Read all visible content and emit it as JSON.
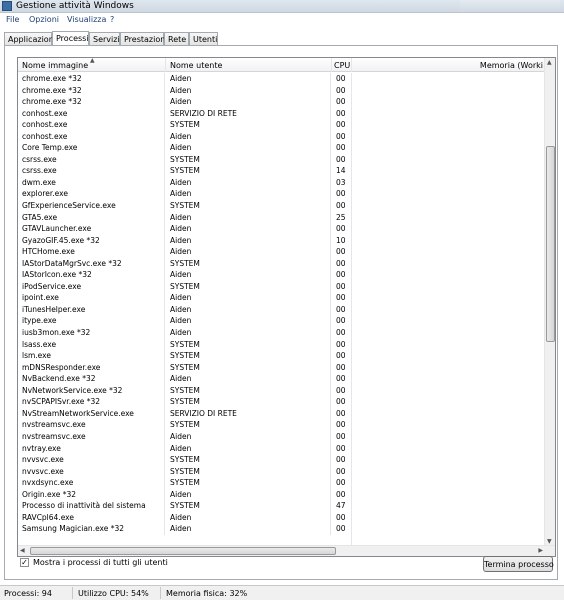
{
  "window": {
    "title": "Gestione attività Windows"
  },
  "menu": [
    "File",
    "Opzioni",
    "Visualizza",
    "?"
  ],
  "tabs": [
    "Applicazioni",
    "Processi",
    "Servizi",
    "Prestazioni",
    "Rete",
    "Utenti"
  ],
  "active_tab": "Processi",
  "columns": {
    "name": "Nome immagine",
    "user": "Nome utente",
    "cpu": "CPU",
    "memory": "Memoria (Worki"
  },
  "processes": [
    [
      "chrome.exe *32",
      "Aiden",
      "00"
    ],
    [
      "chrome.exe *32",
      "Aiden",
      "00"
    ],
    [
      "chrome.exe *32",
      "Aiden",
      "00"
    ],
    [
      "conhost.exe",
      "SERVIZIO DI RETE",
      "00"
    ],
    [
      "conhost.exe",
      "SYSTEM",
      "00"
    ],
    [
      "conhost.exe",
      "Aiden",
      "00"
    ],
    [
      "Core Temp.exe",
      "Aiden",
      "00"
    ],
    [
      "csrss.exe",
      "SYSTEM",
      "00"
    ],
    [
      "csrss.exe",
      "SYSTEM",
      "14"
    ],
    [
      "dwm.exe",
      "Aiden",
      "03"
    ],
    [
      "explorer.exe",
      "Aiden",
      "00"
    ],
    [
      "GfExperienceService.exe",
      "SYSTEM",
      "00"
    ],
    [
      "GTA5.exe",
      "Aiden",
      "25"
    ],
    [
      "GTAVLauncher.exe",
      "Aiden",
      "00"
    ],
    [
      "GyazoGIF.45.exe *32",
      "Aiden",
      "10"
    ],
    [
      "HTCHome.exe",
      "Aiden",
      "00"
    ],
    [
      "IAStorDataMgrSvc.exe *32",
      "SYSTEM",
      "00"
    ],
    [
      "IAStorIcon.exe *32",
      "Aiden",
      "00"
    ],
    [
      "iPodService.exe",
      "SYSTEM",
      "00"
    ],
    [
      "ipoint.exe",
      "Aiden",
      "00"
    ],
    [
      "iTunesHelper.exe",
      "Aiden",
      "00"
    ],
    [
      "itype.exe",
      "Aiden",
      "00"
    ],
    [
      "iusb3mon.exe *32",
      "Aiden",
      "00"
    ],
    [
      "lsass.exe",
      "SYSTEM",
      "00"
    ],
    [
      "lsm.exe",
      "SYSTEM",
      "00"
    ],
    [
      "mDNSResponder.exe",
      "SYSTEM",
      "00"
    ],
    [
      "NvBackend.exe *32",
      "Aiden",
      "00"
    ],
    [
      "NvNetworkService.exe *32",
      "SYSTEM",
      "00"
    ],
    [
      "nvSCPAPISvr.exe *32",
      "SYSTEM",
      "00"
    ],
    [
      "NvStreamNetworkService.exe",
      "SERVIZIO DI RETE",
      "00"
    ],
    [
      "nvstreamsvc.exe",
      "SYSTEM",
      "00"
    ],
    [
      "nvstreamsvc.exe",
      "Aiden",
      "00"
    ],
    [
      "nvtray.exe",
      "Aiden",
      "00"
    ],
    [
      "nvvsvc.exe",
      "SYSTEM",
      "00"
    ],
    [
      "nvvsvc.exe",
      "SYSTEM",
      "00"
    ],
    [
      "nvxdsync.exe",
      "SYSTEM",
      "00"
    ],
    [
      "Origin.exe *32",
      "Aiden",
      "00"
    ],
    [
      "Processo di inattività del sistema",
      "SYSTEM",
      "47"
    ],
    [
      "RAVCpl64.exe",
      "Aiden",
      "00"
    ],
    [
      "Samsung Magician.exe *32",
      "Aiden",
      "00"
    ]
  ],
  "show_all_users": {
    "label": "Mostra i processi di tutti gli utenti",
    "checked": true
  },
  "end_process_button": "Termina processo",
  "status": {
    "processes": "Processi: 94",
    "cpu": "Utilizzo CPU: 54%",
    "memory": "Memoria fisica: 32%"
  }
}
